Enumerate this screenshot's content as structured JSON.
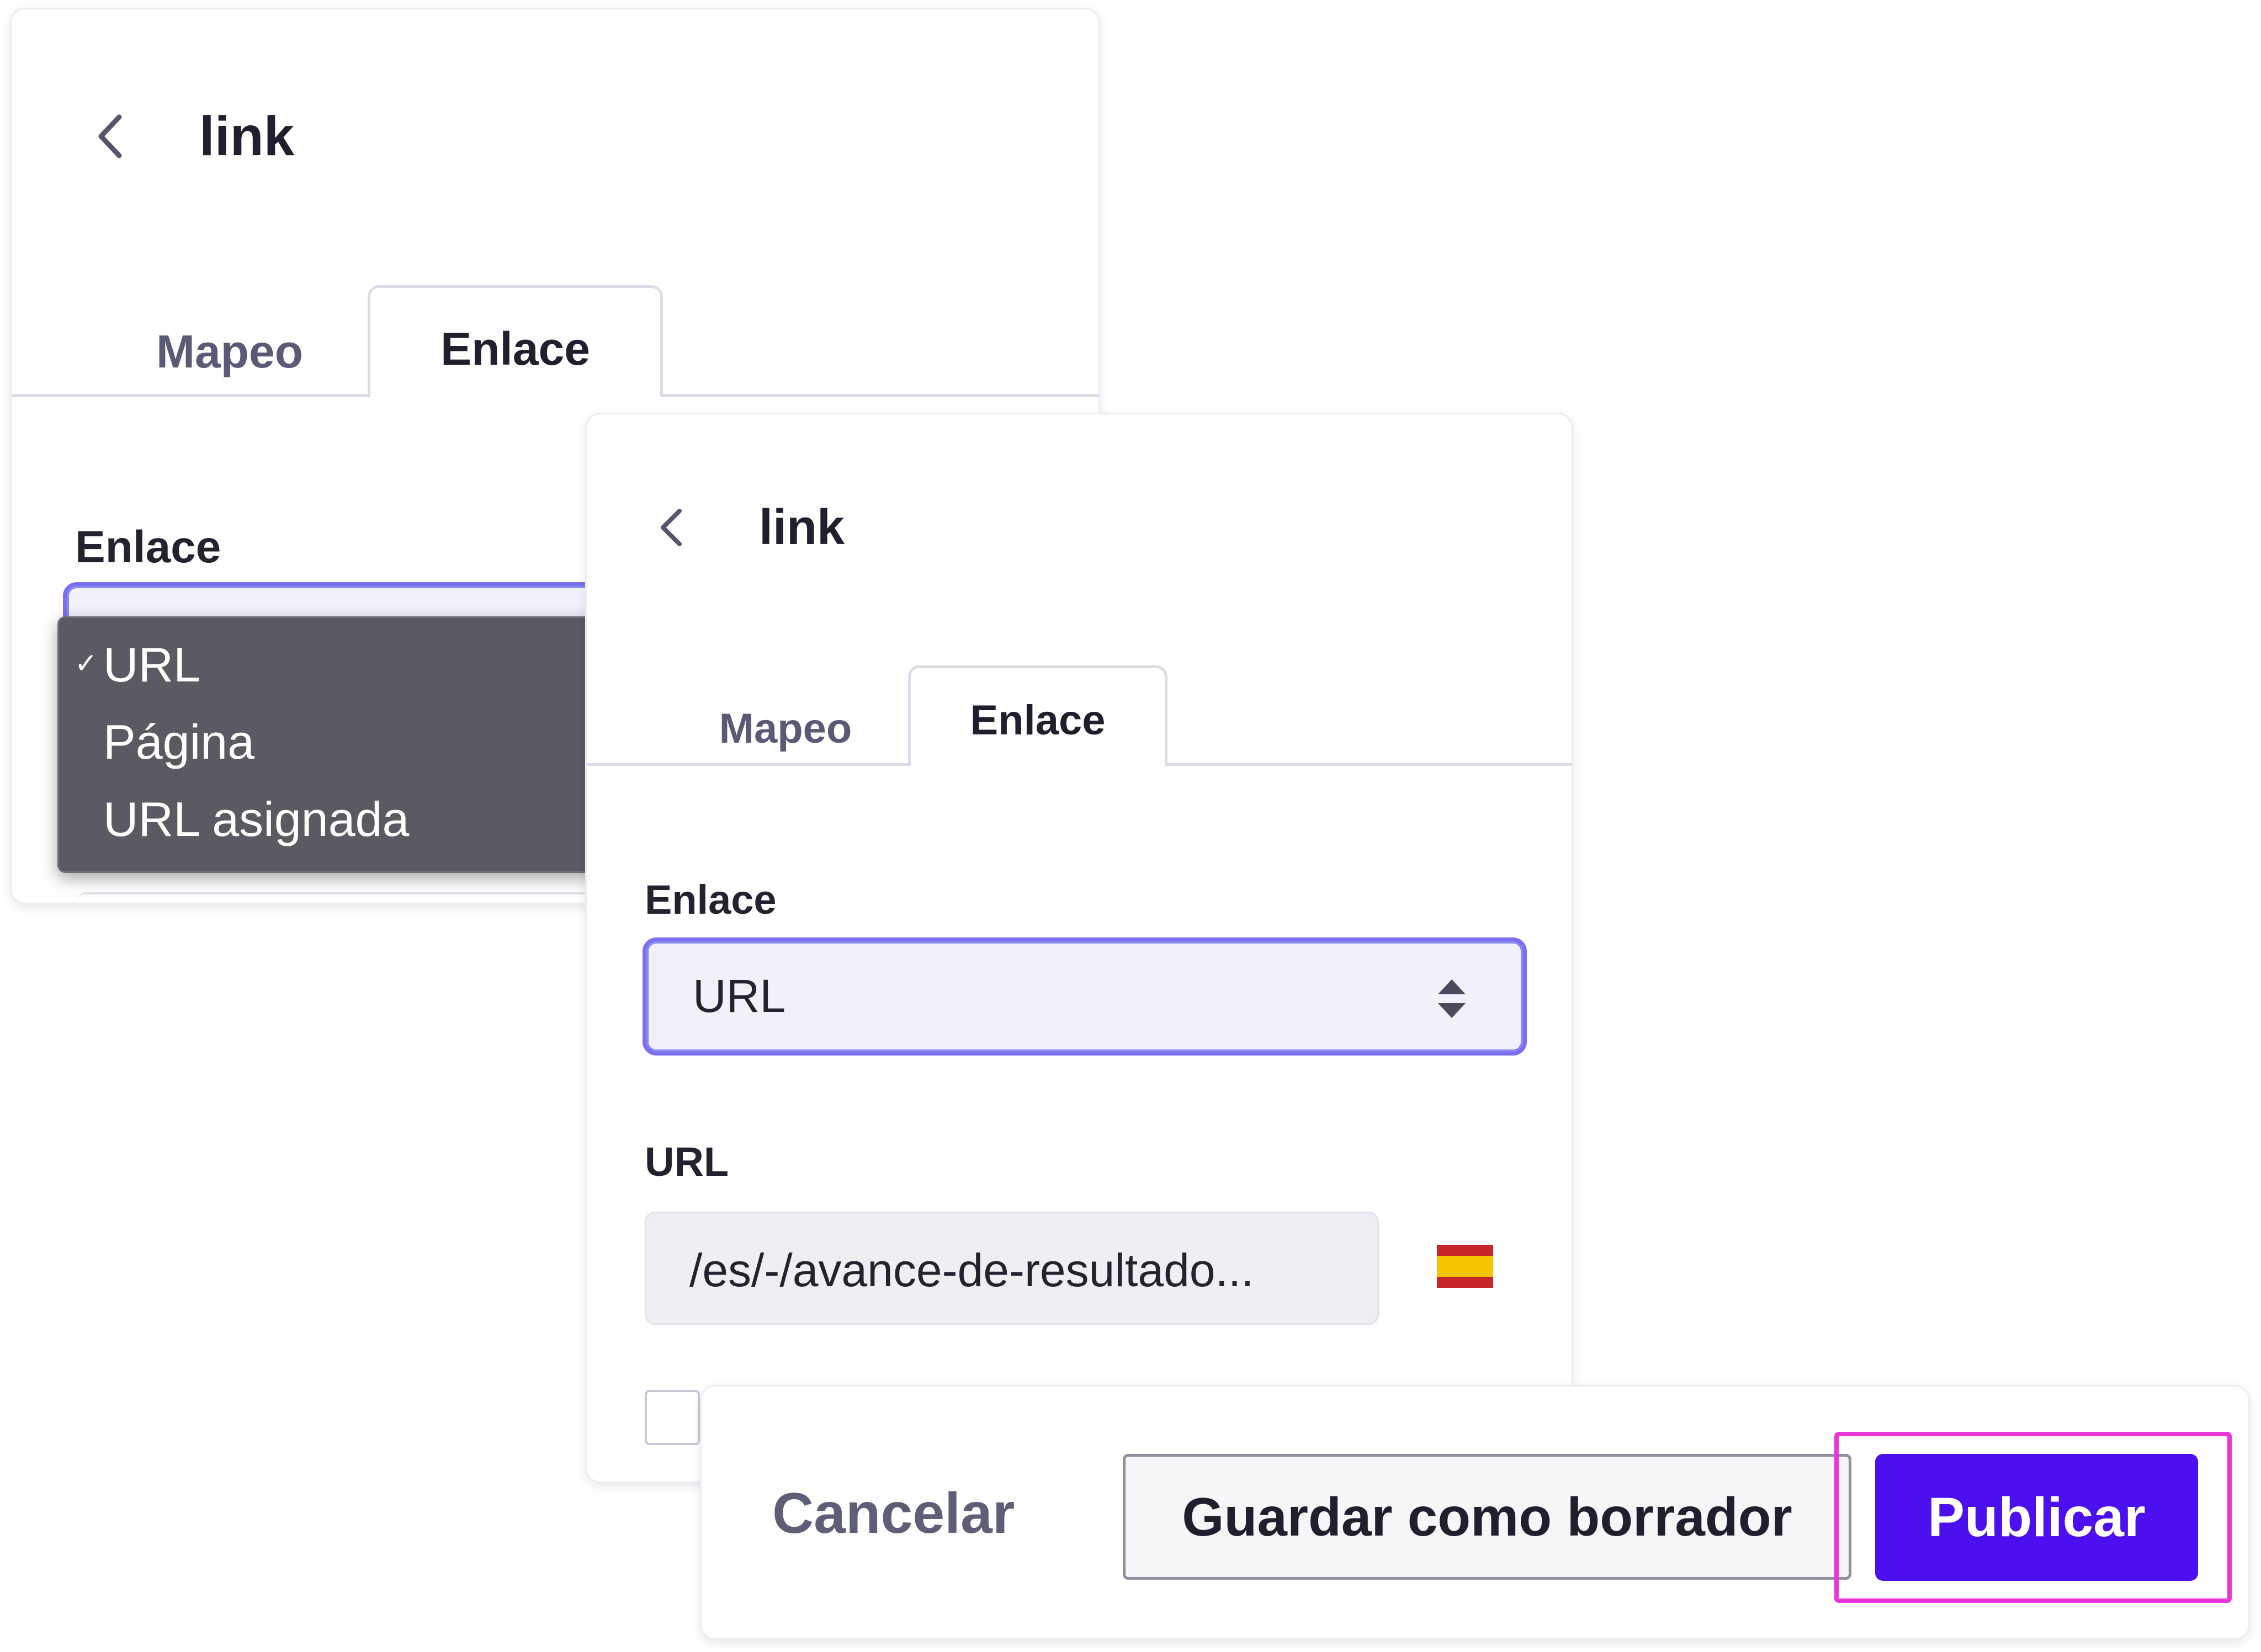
{
  "back_panel": {
    "title": "link",
    "tabs": [
      {
        "label": "Mapeo",
        "active": false
      },
      {
        "label": "Enlace",
        "active": true
      }
    ],
    "field_label": "Enlace",
    "dropdown": {
      "options": [
        {
          "label": "URL",
          "checked": true
        },
        {
          "label": "Página",
          "checked": false
        },
        {
          "label": "URL asignada",
          "checked": false
        }
      ],
      "check_mark": "✓"
    }
  },
  "front_panel": {
    "title": "link",
    "tabs": [
      {
        "label": "Mapeo",
        "active": false
      },
      {
        "label": "Enlace",
        "active": true
      }
    ],
    "link_label": "Enlace",
    "link_select_value": "URL",
    "url_label": "URL",
    "url_value": "/es/-/avance-de-resultado...",
    "flag": {
      "name": "spain-flag-icon",
      "colors": [
        "#c8262b",
        "#f4c400",
        "#c8262b"
      ]
    },
    "checkbox_checked": false
  },
  "footer": {
    "cancel_label": "Cancelar",
    "draft_label": "Guardar como borrador",
    "publish_label": "Publicar"
  },
  "colors": {
    "accent": "#4b0ff0",
    "focus_ring": "#7a6ff0",
    "highlight": "#ea36d8",
    "dropdown_bg": "#5a5a63"
  }
}
